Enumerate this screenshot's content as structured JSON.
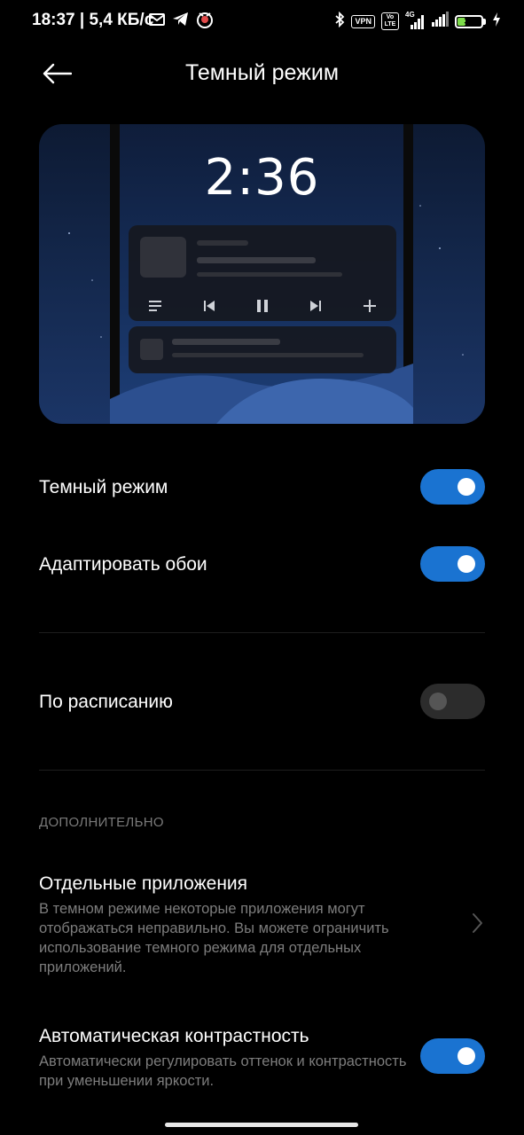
{
  "status_bar": {
    "time": "18:37 | 5,4 КБ/с",
    "vpn": "VPN",
    "volte": "Vo LTE",
    "network": "4G",
    "battery": "36",
    "battery_level": 0.36,
    "icons": [
      "mail-icon",
      "telegram-icon",
      "app-icon",
      "bluetooth-icon",
      "signal-icon",
      "signal-icon",
      "charging-icon"
    ]
  },
  "header": {
    "title": "Темный режим"
  },
  "preview": {
    "clock": "2:36",
    "media_icons": [
      "playlist-icon",
      "previous-icon",
      "pause-icon",
      "next-icon",
      "add-icon"
    ]
  },
  "settings": {
    "dark_mode": {
      "label": "Темный режим",
      "enabled": true
    },
    "adapt_wallpaper": {
      "label": "Адаптировать обои",
      "enabled": true
    },
    "schedule": {
      "label": "По расписанию",
      "enabled": false
    }
  },
  "additional": {
    "header": "ДОПОЛНИТЕЛЬНО",
    "separate_apps": {
      "title": "Отдельные приложения",
      "description": "В темном режиме некоторые приложения могут отображаться неправильно. Вы можете ограничить использование темного режима для отдельных приложений."
    },
    "auto_contrast": {
      "title": "Автоматическая контрастность",
      "description": "Автоматически регулировать оттенок и контрастность при уменьшении яркости.",
      "enabled": true
    }
  },
  "colors": {
    "background": "#000000",
    "accent": "#1a73d1",
    "secondary_text": "#7d7d7d"
  }
}
